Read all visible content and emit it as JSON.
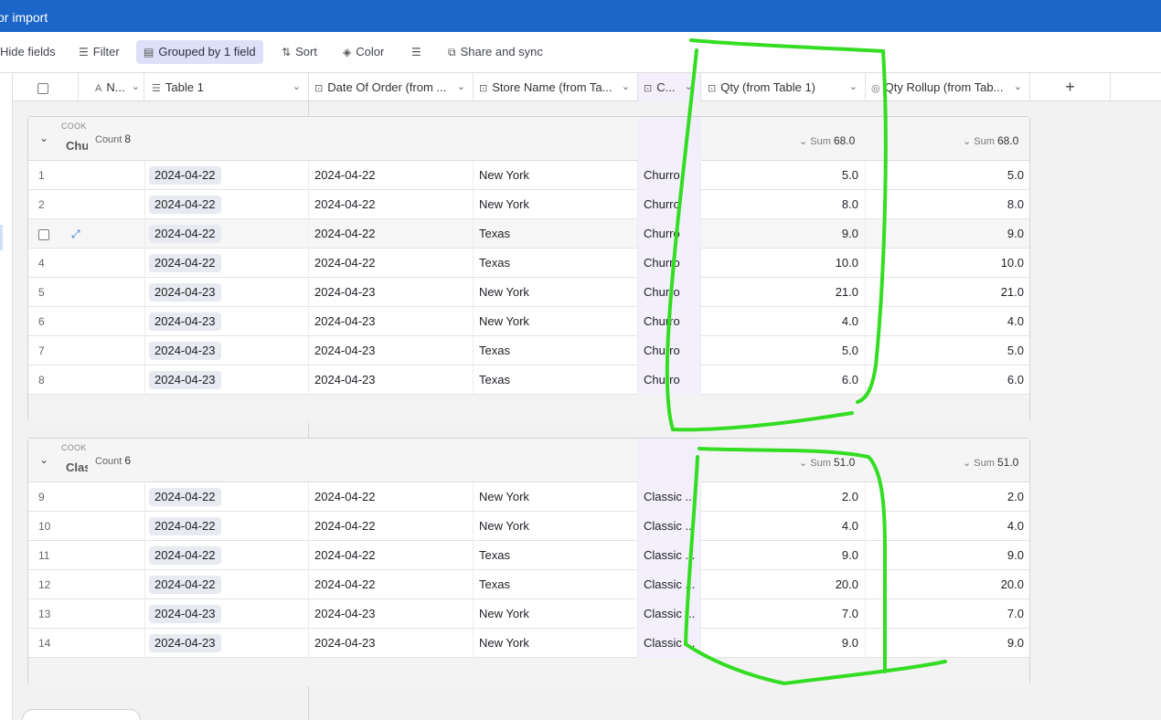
{
  "topbar": {
    "title": "or import"
  },
  "toolbar": {
    "hide_fields": "Hide fields",
    "filter": "Filter",
    "grouped": "Grouped by 1 field",
    "sort": "Sort",
    "color": "Color",
    "share": "Share and sync"
  },
  "columns": {
    "name": "N...",
    "table1": "Table 1",
    "date": "Date Of Order (from ...",
    "store": "Store Name (from Ta...",
    "cookie": "C...",
    "qty": "Qty (from Table 1)",
    "rollup": "Qty Rollup (from Tab..."
  },
  "groups": [
    {
      "field": "COOKIE",
      "value": "Churro",
      "count_label": "Count",
      "count": "8",
      "sum_label": "Sum",
      "qty_sum": "68.0",
      "rollup_sum": "68.0",
      "rows": [
        {
          "n": "1",
          "t1": "2024-04-22",
          "date": "2024-04-22",
          "store": "New York",
          "cookie": "Churro",
          "qty": "5.0",
          "rollup": "5.0"
        },
        {
          "n": "2",
          "t1": "2024-04-22",
          "date": "2024-04-22",
          "store": "New York",
          "cookie": "Churro",
          "qty": "8.0",
          "rollup": "8.0"
        },
        {
          "n": "",
          "t1": "2024-04-22",
          "date": "2024-04-22",
          "store": "Texas",
          "cookie": "Churro",
          "qty": "9.0",
          "rollup": "9.0"
        },
        {
          "n": "4",
          "t1": "2024-04-22",
          "date": "2024-04-22",
          "store": "Texas",
          "cookie": "Churro",
          "qty": "10.0",
          "rollup": "10.0"
        },
        {
          "n": "5",
          "t1": "2024-04-23",
          "date": "2024-04-23",
          "store": "New York",
          "cookie": "Churro",
          "qty": "21.0",
          "rollup": "21.0"
        },
        {
          "n": "6",
          "t1": "2024-04-23",
          "date": "2024-04-23",
          "store": "New York",
          "cookie": "Churro",
          "qty": "4.0",
          "rollup": "4.0"
        },
        {
          "n": "7",
          "t1": "2024-04-23",
          "date": "2024-04-23",
          "store": "Texas",
          "cookie": "Churro",
          "qty": "5.0",
          "rollup": "5.0"
        },
        {
          "n": "8",
          "t1": "2024-04-23",
          "date": "2024-04-23",
          "store": "Texas",
          "cookie": "Churro",
          "qty": "6.0",
          "rollup": "6.0"
        }
      ]
    },
    {
      "field": "COOKIE",
      "value": "Classic",
      "count_label": "Count",
      "count": "6",
      "sum_label": "Sum",
      "qty_sum": "51.0",
      "rollup_sum": "51.0",
      "rows": [
        {
          "n": "9",
          "t1": "2024-04-22",
          "date": "2024-04-22",
          "store": "New York",
          "cookie": "Classic ...",
          "qty": "2.0",
          "rollup": "2.0"
        },
        {
          "n": "10",
          "t1": "2024-04-22",
          "date": "2024-04-22",
          "store": "New York",
          "cookie": "Classic ...",
          "qty": "4.0",
          "rollup": "4.0"
        },
        {
          "n": "11",
          "t1": "2024-04-22",
          "date": "2024-04-22",
          "store": "Texas",
          "cookie": "Classic ...",
          "qty": "9.0",
          "rollup": "9.0"
        },
        {
          "n": "12",
          "t1": "2024-04-22",
          "date": "2024-04-22",
          "store": "Texas",
          "cookie": "Classic ...",
          "qty": "20.0",
          "rollup": "20.0"
        },
        {
          "n": "13",
          "t1": "2024-04-23",
          "date": "2024-04-23",
          "store": "New York",
          "cookie": "Classic ...",
          "qty": "7.0",
          "rollup": "7.0"
        },
        {
          "n": "14",
          "t1": "2024-04-23",
          "date": "2024-04-23",
          "store": "New York",
          "cookie": "Classic ...",
          "qty": "9.0",
          "rollup": "9.0"
        }
      ]
    }
  ],
  "colors": {
    "topbar": "#1c66c9",
    "annotation": "#33dd22",
    "expand_icon": "#2b6fd6"
  }
}
